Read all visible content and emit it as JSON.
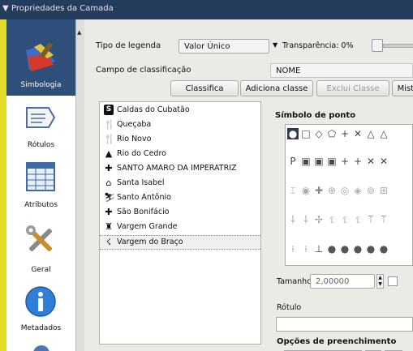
{
  "titlebar": {
    "title": "Propriedades da Camada"
  },
  "sidebar": {
    "items": [
      {
        "label": "Simbologia",
        "icon": "symbology-brush-icon"
      },
      {
        "label": "Rótulos",
        "icon": "label-tag-icon"
      },
      {
        "label": "Atributos",
        "icon": "table-icon"
      },
      {
        "label": "Geral",
        "icon": "tools-icon"
      },
      {
        "label": "Metadados",
        "icon": "info-icon"
      }
    ]
  },
  "legend": {
    "type_label": "Tipo de legenda",
    "type_value": "Valor Único",
    "transparency_label": "Transparência: 0%",
    "field_label": "Campo de classificação",
    "field_value": "NOME"
  },
  "buttons": {
    "classify": "Classifica",
    "add_class": "Adiciona classe",
    "delete_class": "Exclui Classe",
    "mix": "Mistu"
  },
  "classes": [
    {
      "name": "Caldas do Cubatão",
      "icon": "bold-s-icon"
    },
    {
      "name": "Queçaba",
      "icon": "fork-knife-icon"
    },
    {
      "name": "Rio Novo",
      "icon": "fork-knife-icon"
    },
    {
      "name": "Rio do Cedro",
      "icon": "mountain-icon"
    },
    {
      "name": "SANTO AMARO DA IMPERATRIZ",
      "icon": "hospital-cross-icon"
    },
    {
      "name": "Santa Isabel",
      "icon": "house-icon"
    },
    {
      "name": "Santo Antônio",
      "icon": "skier-icon"
    },
    {
      "name": "São Bonifácio",
      "icon": "hospital-cross-icon"
    },
    {
      "name": "Vargem Grande",
      "icon": "hiker-icon"
    },
    {
      "name": "Vargem do Braço",
      "icon": "walker-icon"
    }
  ],
  "symbol_panel": {
    "title": "Símbolo de ponto",
    "size_label": "Tamanho",
    "size_value": "2,00000",
    "label_title": "Rótulo",
    "fill_title": "Opções de preenchimento",
    "fill_more": "..."
  },
  "symbols": [
    [
      "●",
      "□",
      "◇",
      "⬠",
      "+",
      "✕",
      "△",
      "△"
    ],
    [
      "P",
      "▣",
      "▣",
      "▣",
      "+",
      "+",
      "✕",
      "✕"
    ],
    [
      "⌶",
      "◉",
      "✚",
      "⊕",
      "◎",
      "◈",
      "⊚",
      "⊞"
    ],
    [
      "⸸",
      "⸸",
      "✢",
      "⟟",
      "⟟",
      "⟟",
      "⟙",
      "⟙"
    ],
    [
      "⟊",
      "⟊",
      "⊥",
      "●",
      "●",
      "●",
      "●",
      "●"
    ]
  ],
  "colors": {
    "accent": "#2f4f7b",
    "titlebar": "#253c5c",
    "background": "#e4dc2b"
  }
}
